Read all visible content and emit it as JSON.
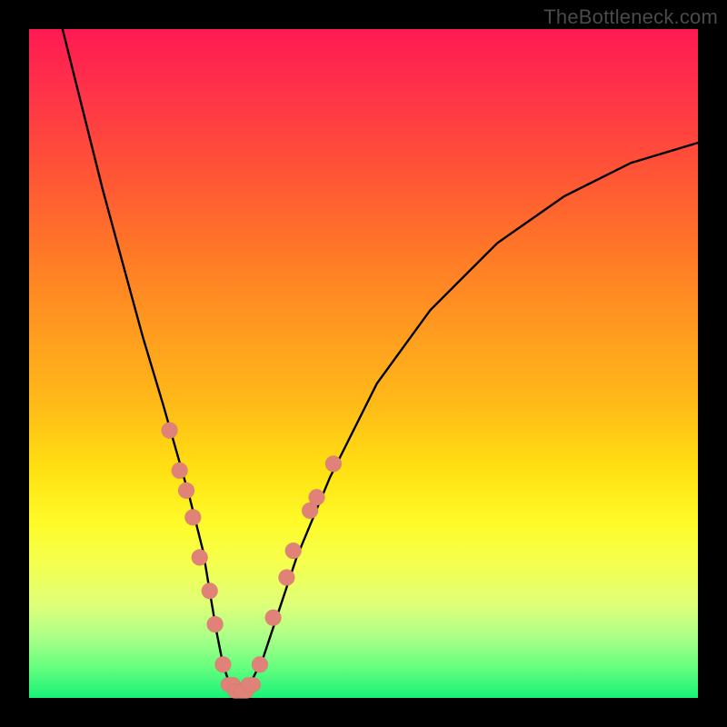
{
  "watermark": "TheBottleneck.com",
  "colors": {
    "dot": "#e18279",
    "curve": "#000000",
    "frame": "#000000"
  },
  "chart_data": {
    "type": "line",
    "title": "",
    "xlabel": "",
    "ylabel": "",
    "xlim": [
      0,
      100
    ],
    "ylim": [
      0,
      100
    ],
    "grid": false,
    "legend": false,
    "series": [
      {
        "name": "bottleneck-curve",
        "x": [
          5,
          8,
          11,
          14,
          17,
          20,
          22,
          24,
          26,
          27,
          28,
          29,
          30,
          32,
          33,
          35,
          37,
          40,
          45,
          52,
          60,
          70,
          80,
          90,
          100
        ],
        "y": [
          100,
          88,
          76,
          65,
          54,
          44,
          37,
          30,
          22,
          16,
          10,
          5,
          2,
          1,
          2,
          6,
          12,
          21,
          33,
          47,
          58,
          68,
          75,
          80,
          83
        ]
      }
    ],
    "markers": [
      {
        "x": 21.0,
        "y": 40
      },
      {
        "x": 22.5,
        "y": 34
      },
      {
        "x": 23.5,
        "y": 31
      },
      {
        "x": 24.5,
        "y": 27
      },
      {
        "x": 25.5,
        "y": 21
      },
      {
        "x": 27.0,
        "y": 16
      },
      {
        "x": 27.8,
        "y": 11
      },
      {
        "x": 29.0,
        "y": 5
      },
      {
        "x": 30.0,
        "y": 2
      },
      {
        "x": 31.0,
        "y": 1
      },
      {
        "x": 32.0,
        "y": 1
      },
      {
        "x": 33.0,
        "y": 2
      },
      {
        "x": 34.5,
        "y": 5
      },
      {
        "x": 36.5,
        "y": 12
      },
      {
        "x": 38.5,
        "y": 18
      },
      {
        "x": 39.5,
        "y": 22
      },
      {
        "x": 42.0,
        "y": 28
      },
      {
        "x": 43.0,
        "y": 30
      },
      {
        "x": 45.5,
        "y": 35
      }
    ],
    "annotations": []
  }
}
